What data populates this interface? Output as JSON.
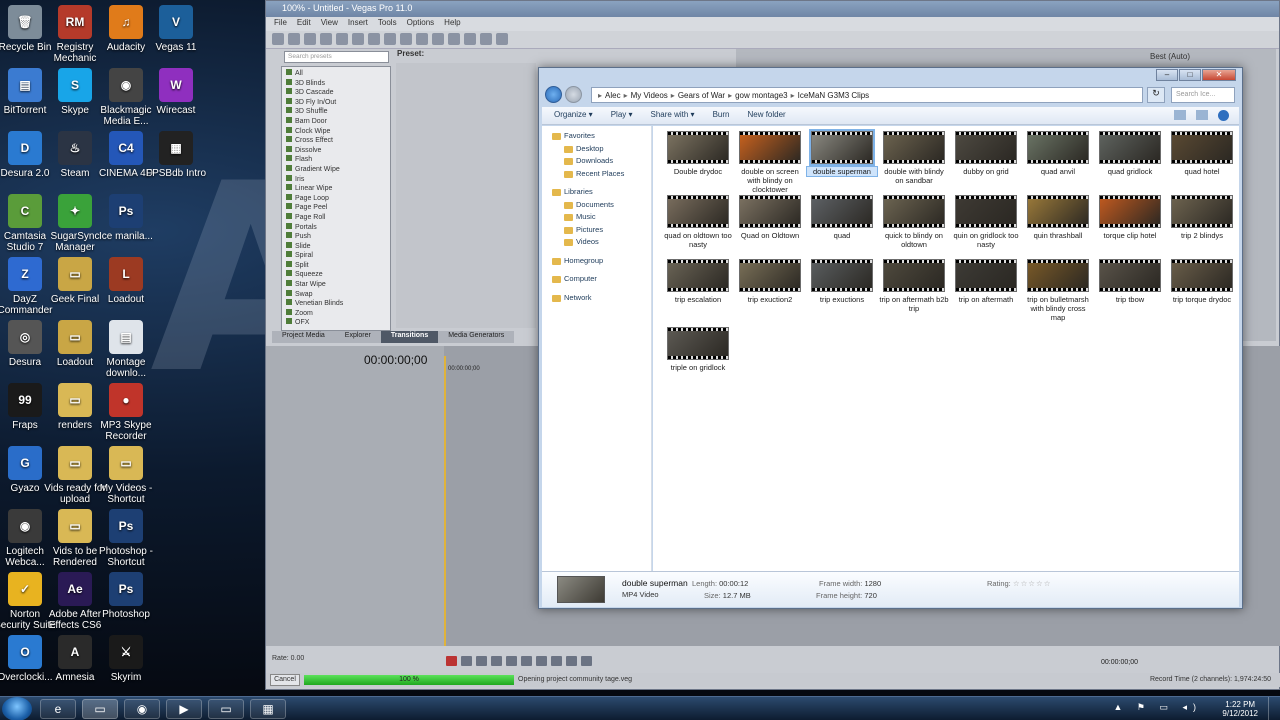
{
  "desktop": {
    "background_text": "AI",
    "icons": [
      {
        "label": "Recycle Bin",
        "color": "#7d8c99",
        "glyph": "🗑"
      },
      {
        "label": "Registry Mechanic",
        "color": "#b53a2a",
        "glyph": "RM"
      },
      {
        "label": "Audacity",
        "color": "#e07b1a",
        "glyph": "♫"
      },
      {
        "label": "Vegas 11",
        "color": "#1c5f9a",
        "glyph": "V"
      },
      {
        "label": "BitTorrent",
        "color": "#3b7bd1",
        "glyph": "▤"
      },
      {
        "label": "Skype",
        "color": "#18a5e8",
        "glyph": "S"
      },
      {
        "label": "Blackmagic Media E...",
        "color": "#444",
        "glyph": "◉"
      },
      {
        "label": "Wirecast",
        "color": "#8f2fbf",
        "glyph": "W"
      },
      {
        "label": "Desura 2.0",
        "color": "#2a7ad1",
        "glyph": "D"
      },
      {
        "label": "Steam",
        "color": "#2b3444",
        "glyph": "♨"
      },
      {
        "label": "CINEMA 4D",
        "color": "#2457b8",
        "glyph": "C4"
      },
      {
        "label": "FPSBdb Intro",
        "color": "#222",
        "glyph": "▦"
      },
      {
        "label": "Camtasia Studio 7",
        "color": "#5a9c3a",
        "glyph": "C"
      },
      {
        "label": "SugarSync Manager",
        "color": "#3aa23a",
        "glyph": "✦"
      },
      {
        "label": "Ice manila...",
        "color": "#1d3f73",
        "glyph": "Ps"
      },
      {
        "label": "DayZ Commander",
        "color": "#2e6ad1",
        "glyph": "Z"
      },
      {
        "label": "Geek Final",
        "color": "#c9a645",
        "glyph": "▭"
      },
      {
        "label": "Loadout",
        "color": "#9c3a22",
        "glyph": "L"
      },
      {
        "label": "Desura",
        "color": "#555",
        "glyph": "◎"
      },
      {
        "label": "Loadout",
        "color": "#c9a645",
        "glyph": "▭"
      },
      {
        "label": "Montage downlo...",
        "color": "#dfe4ea",
        "glyph": "▤"
      },
      {
        "label": "Fraps",
        "color": "#1a1a1a",
        "glyph": "99"
      },
      {
        "label": "renders",
        "color": "#d9b855",
        "glyph": "▭"
      },
      {
        "label": "MP3 Skype Recorder",
        "color": "#c0342a",
        "glyph": "●"
      },
      {
        "label": "Gyazo",
        "color": "#2a6dc9",
        "glyph": "G"
      },
      {
        "label": "Vids ready for upload",
        "color": "#d9b855",
        "glyph": "▭"
      },
      {
        "label": "My Videos - Shortcut",
        "color": "#d9b855",
        "glyph": "▭"
      },
      {
        "label": "Logitech Webca...",
        "color": "#3a3a3a",
        "glyph": "◉"
      },
      {
        "label": "Vids to be Rendered",
        "color": "#d9b855",
        "glyph": "▭"
      },
      {
        "label": "Photoshop - Shortcut",
        "color": "#1d3f73",
        "glyph": "Ps"
      },
      {
        "label": "Norton Security Suite",
        "color": "#e8b320",
        "glyph": "✓"
      },
      {
        "label": "Adobe After Effects CS6",
        "color": "#2a1a55",
        "glyph": "Ae"
      },
      {
        "label": "Photoshop",
        "color": "#1d3f73",
        "glyph": "Ps"
      },
      {
        "label": "Overclocki...",
        "color": "#2a7ad1",
        "glyph": "O"
      },
      {
        "label": "Amnesia",
        "color": "#2a2a2a",
        "glyph": "A"
      },
      {
        "label": "Skyrim",
        "color": "#1a1a1a",
        "glyph": "⚔"
      }
    ]
  },
  "vegas": {
    "title": "100% - Untitled - Vegas Pro 11.0",
    "menu": [
      "File",
      "Edit",
      "View",
      "Insert",
      "Tools",
      "Options",
      "Help"
    ],
    "search_placeholder": "Search presets",
    "preset_label": "Preset:",
    "transitions": [
      "All",
      "3D Blinds",
      "3D Cascade",
      "3D Fly In/Out",
      "3D Shuffle",
      "Barn Door",
      "Clock Wipe",
      "Cross Effect",
      "Dissolve",
      "Flash",
      "Gradient Wipe",
      "Iris",
      "Linear Wipe",
      "Page Loop",
      "Page Peel",
      "Page Roll",
      "Portals",
      "Push",
      "Slide",
      "Spiral",
      "Split",
      "Squeeze",
      "Star Wipe",
      "Swap",
      "Venetian Blinds",
      "Zoom",
      "OFX"
    ],
    "tabs": [
      "Project Media",
      "Explorer",
      "Transitions",
      "Media Generators"
    ],
    "active_tab": "Transitions",
    "timecode": "00:00:00;00",
    "ruler_tc": "00:00:00;00",
    "preview_quality": "Best (Auto)",
    "rate": "Rate: 0.00",
    "cancel": "Cancel",
    "progress_text": "100 %",
    "progress_value": 1.0,
    "status_msg": "Opening project community tage.veg",
    "tc_right": "00:00:00;00",
    "record_time": "Record Time (2 channels): 1,974:24:50"
  },
  "explorer": {
    "breadcrumb": [
      "Alec",
      "My Videos",
      "Gears of War",
      "gow montage3",
      "IceMaN G3M3 Clips"
    ],
    "search_placeholder": "Search Ice...",
    "commands": [
      "Organize ▾",
      "Play ▾",
      "Share with ▾",
      "Burn",
      "New folder"
    ],
    "nav": [
      {
        "label": "Favorites",
        "sub": false
      },
      {
        "label": "Desktop",
        "sub": true
      },
      {
        "label": "Downloads",
        "sub": true
      },
      {
        "label": "Recent Places",
        "sub": true
      },
      {
        "label": "",
        "sub": false,
        "gap": true
      },
      {
        "label": "Libraries",
        "sub": false
      },
      {
        "label": "Documents",
        "sub": true
      },
      {
        "label": "Music",
        "sub": true
      },
      {
        "label": "Pictures",
        "sub": true
      },
      {
        "label": "Videos",
        "sub": true
      },
      {
        "label": "",
        "sub": false,
        "gap": true
      },
      {
        "label": "Homegroup",
        "sub": false
      },
      {
        "label": "",
        "sub": false,
        "gap": true
      },
      {
        "label": "Computer",
        "sub": false
      },
      {
        "label": "",
        "sub": false,
        "gap": true
      },
      {
        "label": "Network",
        "sub": false
      }
    ],
    "files": [
      {
        "name": "Double drydoc",
        "tint": "#7d7462"
      },
      {
        "name": "double on screen with blindy on clocktower",
        "tint": "#c9621e"
      },
      {
        "name": "double superman",
        "tint": "#8b8a82",
        "selected": true
      },
      {
        "name": "double with blindy on sandbar",
        "tint": "#6d6450"
      },
      {
        "name": "dubby on grid",
        "tint": "#4e4a42"
      },
      {
        "name": "quad anvil",
        "tint": "#6b7566"
      },
      {
        "name": "quad gridlock",
        "tint": "#5f6460"
      },
      {
        "name": "quad hotel",
        "tint": "#5b4a33"
      },
      {
        "name": "quad on oldtown too nasty",
        "tint": "#7a6e5e"
      },
      {
        "name": "Quad on Oldtown",
        "tint": "#7c7262"
      },
      {
        "name": "quad",
        "tint": "#5e6266"
      },
      {
        "name": "quick to blindy on oldtown",
        "tint": "#6d6552"
      },
      {
        "name": "quin on gridlock too nasty",
        "tint": "#3e3a34"
      },
      {
        "name": "quin thrashball",
        "tint": "#9b7a3a"
      },
      {
        "name": "torque clip hotel",
        "tint": "#c25a1f"
      },
      {
        "name": "trip 2 blindys",
        "tint": "#6e6450"
      },
      {
        "name": "trip escalation",
        "tint": "#6a6456"
      },
      {
        "name": "trip exuction2",
        "tint": "#7a7058"
      },
      {
        "name": "trip exuctions",
        "tint": "#5a5e60"
      },
      {
        "name": "trip on aftermath b2b trip",
        "tint": "#4f4a3e"
      },
      {
        "name": "trip on aftermath",
        "tint": "#3d3b36"
      },
      {
        "name": "trip on bulletmarsh with blindy cross map",
        "tint": "#7a5a28"
      },
      {
        "name": "trip tbow",
        "tint": "#5a544a"
      },
      {
        "name": "trip torque drydoc",
        "tint": "#6a5e4a"
      },
      {
        "name": "triple on gridlock",
        "tint": "#5d5a54"
      }
    ],
    "details": {
      "name": "double superman",
      "type": "MP4 Video",
      "length_label": "Length:",
      "length": "00:00:12",
      "size_label": "Size:",
      "size": "12.7 MB",
      "fw_label": "Frame width:",
      "fw": "1280",
      "fh_label": "Frame height:",
      "fh": "720",
      "rating_label": "Rating:",
      "rating": "☆☆☆☆☆"
    }
  },
  "taskbar": {
    "time": "1:22 PM",
    "date": "9/12/2012",
    "tray": "▲ ⚑ ▭ ◂)"
  }
}
